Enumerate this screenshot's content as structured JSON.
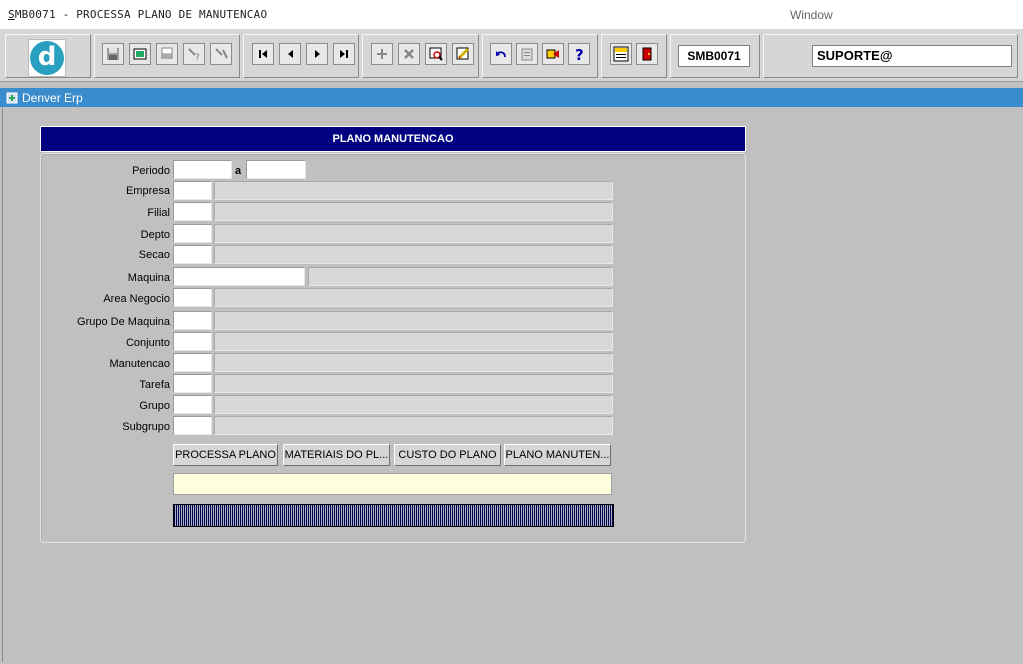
{
  "window": {
    "title_prefix": "S",
    "title_rest": "MB0071 - PROCESSA PLANO DE MANUTENCAO",
    "menu_window": "Window"
  },
  "toolbar": {
    "logo_letter": "d",
    "form_code": "SMB0071",
    "user": "SUPORTE@",
    "icons": [
      "save-icon",
      "clear-form-icon",
      "print-icon",
      "query-icon",
      "query-run-icon",
      "first-record-icon",
      "previous-record-icon",
      "next-record-icon",
      "last-record-icon",
      "insert-record-icon",
      "delete-record-icon",
      "search-list-icon",
      "edit-icon",
      "undo-icon",
      "paste-icon",
      "navigate-icon",
      "help-icon",
      "menu-icon",
      "exit-icon"
    ]
  },
  "inner_window": {
    "title": "Denver Erp"
  },
  "form": {
    "header": "PLANO MANUTENCAO",
    "labels": {
      "periodo": "Periodo",
      "periodo_sep": "a",
      "empresa": "Empresa",
      "filial": "Filial",
      "depto": "Depto",
      "secao": "Secao",
      "maquina": "Maquina",
      "area_negocio": "Area Negocio",
      "grupo_maquina": "Grupo De Maquina",
      "conjunto": "Conjunto",
      "manutencao": "Manutencao",
      "tarefa": "Tarefa",
      "grupo": "Grupo",
      "subgrupo": "Subgrupo"
    },
    "values": {
      "periodo_de": "",
      "periodo_ate": "",
      "empresa": "",
      "empresa_desc": "",
      "filial": "",
      "filial_desc": "",
      "depto": "",
      "depto_desc": "",
      "secao": "",
      "secao_desc": "",
      "maquina": "",
      "maquina_desc": "",
      "area_negocio": "",
      "area_negocio_desc": "",
      "grupo_maquina": "",
      "grupo_maquina_desc": "",
      "conjunto": "",
      "conjunto_desc": "",
      "manutencao": "",
      "manutencao_desc": "",
      "tarefa": "",
      "tarefa_desc": "",
      "grupo": "",
      "grupo_desc": "",
      "subgrupo": "",
      "subgrupo_desc": "",
      "message": ""
    },
    "buttons": {
      "processa": "PROCESSA PLANO",
      "materiais": "MATERIAIS DO PL...",
      "custo": "CUSTO DO PLANO",
      "plano": "PLANO MANUTEN..."
    }
  }
}
